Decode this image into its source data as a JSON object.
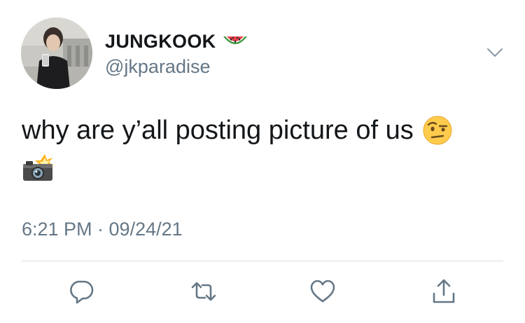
{
  "tweet": {
    "display_name": "JUNGKOOK",
    "name_emoji": "watermelon-emoji",
    "handle": "@jkparadise",
    "text_line1": "why are y’all posting picture of us",
    "text_emoji1": "face-with-raised-eyebrow-emoji",
    "text_emoji2": "camera-with-flash-emoji",
    "timestamp": "6:21 PM · 09/24/21"
  },
  "actions": [
    {
      "icon": "reply-icon"
    },
    {
      "icon": "retweet-icon"
    },
    {
      "icon": "like-icon"
    },
    {
      "icon": "share-icon"
    }
  ],
  "colors": {
    "primary_text": "#14171a",
    "secondary_text": "#657786",
    "divider": "#d8dde1",
    "icon": "#657786"
  }
}
